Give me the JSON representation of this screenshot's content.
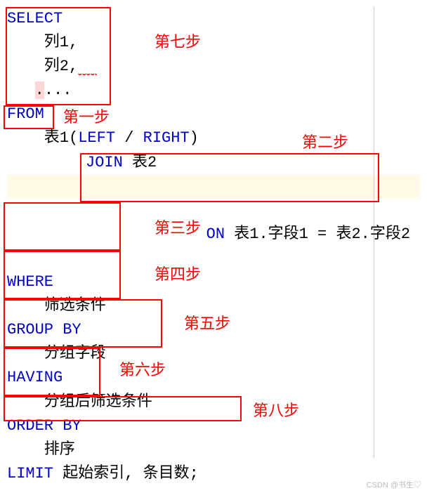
{
  "code": {
    "select": "SELECT",
    "col1": "    列1,",
    "col2_a": "    列2",
    "col2_comma": ",",
    "col2_sq": "~~",
    "dots_a": "   ",
    "dots_dot": ".",
    "dots_rest": "...",
    "from": "FROM",
    "table1_a": "    表1(",
    "table1_left": "LEFT",
    "table1_slash": " / ",
    "table1_right": "RIGHT",
    "table1_b": ")",
    "join_kw": "JOIN",
    "join_t": " 表2",
    "on_sp": "         ",
    "on_kw": "ON",
    "on_rest": " 表1.字段1 = 表2.字段2",
    "where": "WHERE",
    "where_cond": "    筛选条件",
    "groupby": "GROUP BY",
    "group_field": "    分组字段",
    "having": "HAVING",
    "having_cond": "    分组后筛选条件",
    "orderby": "ORDER BY",
    "order_f": "    排序",
    "limit": "LIMIT",
    "limit_rest": " 起始索引, 条目数;"
  },
  "anno": {
    "step1": "第一步",
    "step2": "第二步",
    "step3": "第三步",
    "step4": "第四步",
    "step5": "第五步",
    "step6": "第六步",
    "step7": "第七步",
    "step8": "第八步"
  },
  "watermark": "CSDN @书生♡"
}
